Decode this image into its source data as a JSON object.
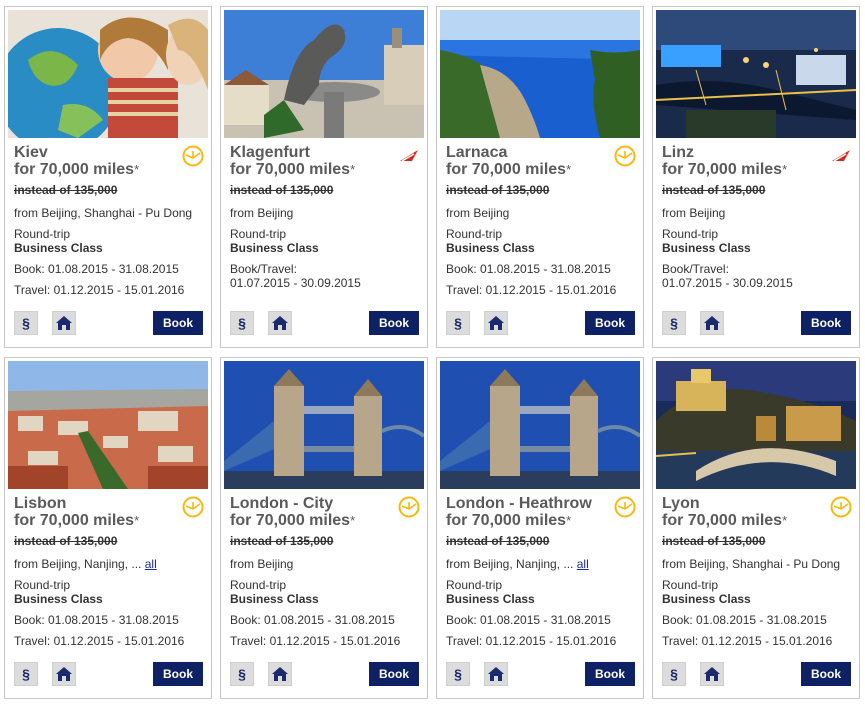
{
  "cards": [
    {
      "city": "Kiev",
      "miles": "for 70,000 miles",
      "star": "*",
      "instead": "instead of 135,000",
      "from": "from Beijing, Shanghai - Pu Dong",
      "from_link": "",
      "trip": "Round-trip",
      "class": "Business Class",
      "book_dates": "Book: 01.08.2015 - 31.08.2015",
      "travel_dates": "Travel: 01.12.2015 - 15.01.2016",
      "book_travel_label": "",
      "book_travel_dates": "",
      "airline": "lufthansa",
      "paragraph_label": "§",
      "book_label": "Book"
    },
    {
      "city": "Klagenfurt",
      "miles": "for 70,000 miles",
      "star": "*",
      "instead": "instead of 135,000",
      "from": "from Beijing",
      "from_link": "",
      "trip": "Round-trip",
      "class": "Business Class",
      "book_dates": "",
      "travel_dates": "",
      "book_travel_label": "Book/Travel:",
      "book_travel_dates": "01.07.2015 - 30.09.2015",
      "airline": "austrian",
      "paragraph_label": "§",
      "book_label": "Book"
    },
    {
      "city": "Larnaca",
      "miles": "for 70,000 miles",
      "star": "*",
      "instead": "instead of 135,000",
      "from": "from Beijing",
      "from_link": "",
      "trip": "Round-trip",
      "class": "Business Class",
      "book_dates": "Book: 01.08.2015 - 31.08.2015",
      "travel_dates": "Travel: 01.12.2015 - 15.01.2016",
      "book_travel_label": "",
      "book_travel_dates": "",
      "airline": "lufthansa",
      "paragraph_label": "§",
      "book_label": "Book"
    },
    {
      "city": "Linz",
      "miles": "for 70,000 miles",
      "star": "*",
      "instead": "instead of 135,000",
      "from": "from Beijing",
      "from_link": "",
      "trip": "Round-trip",
      "class": "Business Class",
      "book_dates": "",
      "travel_dates": "",
      "book_travel_label": "Book/Travel:",
      "book_travel_dates": "01.07.2015 - 30.09.2015",
      "airline": "austrian",
      "paragraph_label": "§",
      "book_label": "Book"
    },
    {
      "city": "Lisbon",
      "miles": "for 70,000 miles",
      "star": "*",
      "instead": "instead of 135,000",
      "from": "from Beijing, Nanjing, ... ",
      "from_link": "all",
      "trip": "Round-trip",
      "class": "Business Class",
      "book_dates": "Book: 01.08.2015 - 31.08.2015",
      "travel_dates": "Travel: 01.12.2015 - 15.01.2016",
      "book_travel_label": "",
      "book_travel_dates": "",
      "airline": "lufthansa",
      "paragraph_label": "§",
      "book_label": "Book"
    },
    {
      "city": "London - City",
      "miles": "for 70,000 miles",
      "star": "*",
      "instead": "instead of 135,000",
      "from": "from Beijing",
      "from_link": "",
      "trip": "Round-trip",
      "class": "Business Class",
      "book_dates": "Book: 01.08.2015 - 31.08.2015",
      "travel_dates": "Travel: 01.12.2015 - 15.01.2016",
      "book_travel_label": "",
      "book_travel_dates": "",
      "airline": "lufthansa",
      "paragraph_label": "§",
      "book_label": "Book"
    },
    {
      "city": "London - Heathrow",
      "miles": "for 70,000 miles",
      "star": "*",
      "instead": "instead of 135,000",
      "from": "from Beijing, Nanjing, ... ",
      "from_link": "all",
      "trip": "Round-trip",
      "class": "Business Class",
      "book_dates": "Book: 01.08.2015 - 31.08.2015",
      "travel_dates": "Travel: 01.12.2015 - 15.01.2016",
      "book_travel_label": "",
      "book_travel_dates": "",
      "airline": "lufthansa",
      "paragraph_label": "§",
      "book_label": "Book"
    },
    {
      "city": "Lyon",
      "miles": "for 70,000 miles",
      "star": "*",
      "instead": "instead of 135,000",
      "from": "from Beijing, Shanghai - Pu Dong",
      "from_link": "",
      "trip": "Round-trip",
      "class": "Business Class",
      "book_dates": "Book: 01.08.2015 - 31.08.2015",
      "travel_dates": "Travel: 01.12.2015 - 15.01.2016",
      "book_travel_label": "",
      "book_travel_dates": "",
      "airline": "lufthansa",
      "paragraph_label": "§",
      "book_label": "Book"
    }
  ],
  "colors": {
    "book_button": "#0e2165",
    "lufthansa_yellow": "#f9b90a",
    "austrian_red": "#d52b1e",
    "link": "#1a2a9a"
  }
}
